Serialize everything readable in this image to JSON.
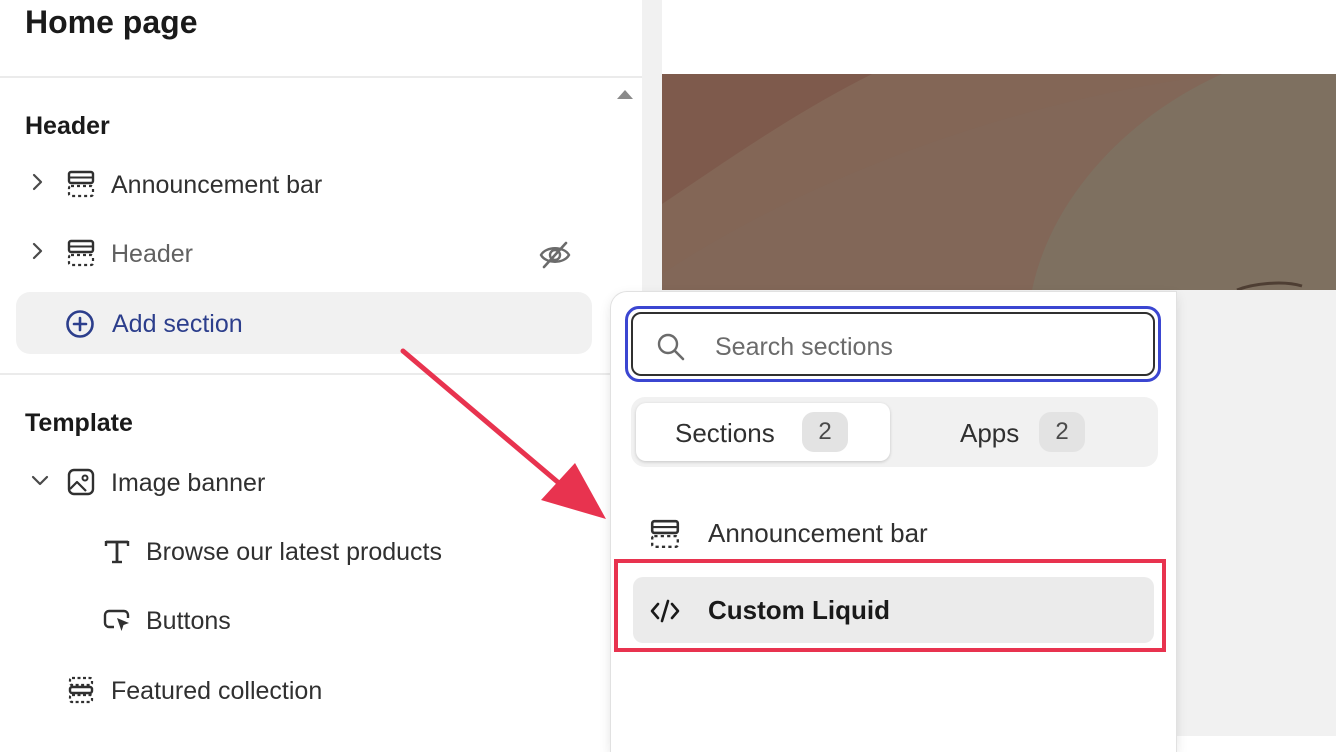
{
  "sidebar": {
    "title": "Home page",
    "header_group": {
      "title": "Header",
      "items": [
        {
          "label": "Announcement bar",
          "icon": "section-icon",
          "expand_icon": "chevron-right-icon"
        },
        {
          "label": "Header",
          "icon": "section-icon",
          "expand_icon": "chevron-right-icon",
          "hidden": true,
          "visibility_icon": "eye-off-icon"
        }
      ],
      "add_section_label": "Add section"
    },
    "template_group": {
      "title": "Template",
      "items": [
        {
          "label": "Image banner",
          "icon": "image-icon",
          "expand_icon": "chevron-down-icon"
        },
        {
          "label": "Browse our latest products",
          "icon": "text-icon"
        },
        {
          "label": "Buttons",
          "icon": "button-icon"
        },
        {
          "label": "Featured collection",
          "icon": "collection-icon"
        }
      ]
    }
  },
  "popover": {
    "search": {
      "placeholder": "Search sections",
      "value": ""
    },
    "tabs": [
      {
        "label": "Sections",
        "count": "2",
        "active": true
      },
      {
        "label": "Apps",
        "count": "2",
        "active": false
      }
    ],
    "results": [
      {
        "label": "Announcement bar",
        "icon": "section-icon"
      },
      {
        "label": "Custom Liquid",
        "icon": "code-icon",
        "highlighted": true
      }
    ]
  },
  "colors": {
    "accent": "#2c3e8c",
    "focus_ring": "#3b46d1",
    "annotation": "#e8334f",
    "banner_brown": "#7e6052"
  }
}
